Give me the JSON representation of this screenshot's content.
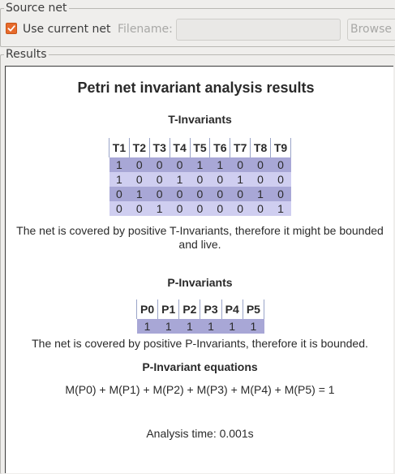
{
  "source_net": {
    "legend": "Source net",
    "use_current_label": "Use current net",
    "use_current_checked": true,
    "filename_label": "Filename:",
    "filename_value": "",
    "browse_label": "Browse"
  },
  "results": {
    "legend": "Results",
    "title": "Petri net invariant analysis results",
    "t_invariants": {
      "heading": "T-Invariants",
      "headers": [
        "T1",
        "T2",
        "T3",
        "T4",
        "T5",
        "T6",
        "T7",
        "T8",
        "T9"
      ],
      "rows": [
        [
          "1",
          "0",
          "0",
          "0",
          "1",
          "1",
          "0",
          "0",
          "0"
        ],
        [
          "1",
          "0",
          "0",
          "1",
          "0",
          "0",
          "1",
          "0",
          "0"
        ],
        [
          "0",
          "1",
          "0",
          "0",
          "0",
          "0",
          "0",
          "1",
          "0"
        ],
        [
          "0",
          "0",
          "1",
          "0",
          "0",
          "0",
          "0",
          "0",
          "1"
        ]
      ],
      "conclusion": "The net is covered by positive T-Invariants, therefore it might be bounded and live."
    },
    "p_invariants": {
      "heading": "P-Invariants",
      "headers": [
        "P0",
        "P1",
        "P2",
        "P3",
        "P4",
        "P5"
      ],
      "rows": [
        [
          "1",
          "1",
          "1",
          "1",
          "1",
          "1"
        ]
      ],
      "conclusion": "The net is covered by positive P-Invariants, therefore it is bounded."
    },
    "p_equations": {
      "heading": "P-Invariant equations",
      "equation": "M(P0) + M(P1) + M(P2) + M(P3) + M(P4) + M(P5) = 1"
    },
    "analysis_time": "Analysis time: 0.001s"
  },
  "colors": {
    "row_dark": "#a8a7d6",
    "row_light": "#cfcef0",
    "checkbox_accent": "#e66a2c"
  }
}
